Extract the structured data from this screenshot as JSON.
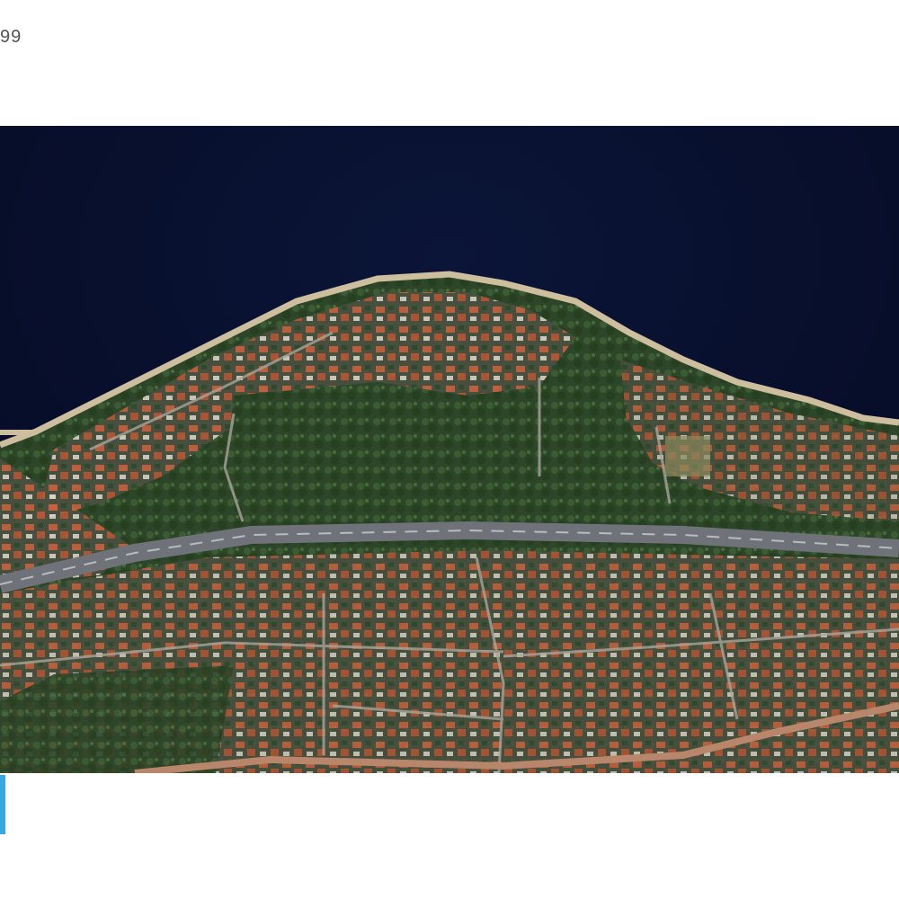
{
  "corner_label": "99",
  "map": {
    "type": "satellite",
    "water_color": "#08102e",
    "vegetation_color": "#2f4a2c",
    "roof_color": "#c8603e",
    "road_color": "#7f8389"
  },
  "accent_tab_color": "#3aa8e0"
}
